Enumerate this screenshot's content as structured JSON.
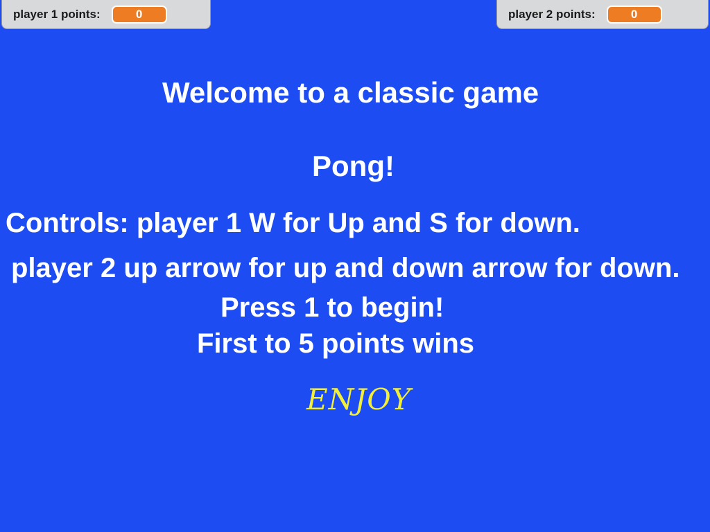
{
  "monitors": {
    "player1": {
      "label": "player 1 points:",
      "value": "0"
    },
    "player2": {
      "label": "player 2 points:",
      "value": "0"
    }
  },
  "stage": {
    "title": "Welcome to a classic game",
    "game_name": "Pong!",
    "controls_line1": "Controls: player 1 W for Up and S for down.",
    "controls_line2": "player 2 up arrow for up and down arrow for down.",
    "start_instruction": "Press 1 to begin!",
    "win_condition": "First to 5 points wins",
    "enjoy": "ENJOY"
  },
  "colors": {
    "stage_background": "#1d4cf2",
    "text": "#ffffff",
    "enjoy_text": "#f2ef3a",
    "monitor_value_background": "#ee7c22",
    "monitor_background": "#d8d9db"
  }
}
